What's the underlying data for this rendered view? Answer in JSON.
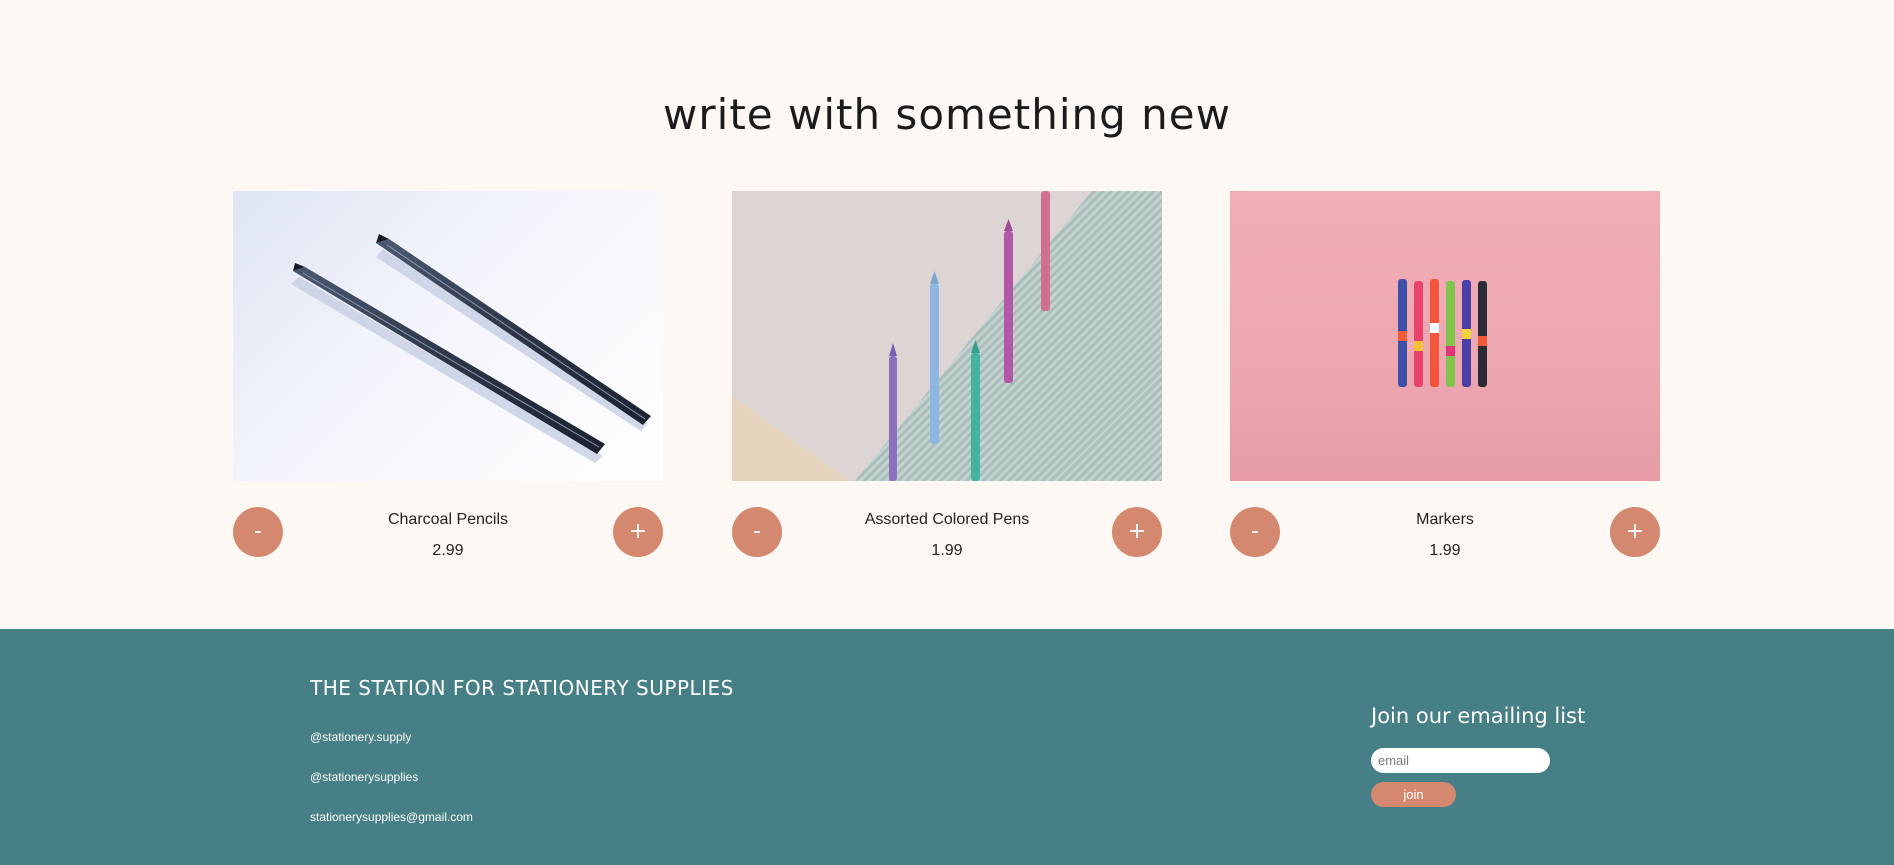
{
  "headline": "write with something new",
  "products": [
    {
      "name": "Charcoal Pencils",
      "price": "2.99",
      "minus_label": "-",
      "plus_label": "+"
    },
    {
      "name": "Assorted Colored Pens",
      "price": "1.99",
      "minus_label": "-",
      "plus_label": "+"
    },
    {
      "name": "Markers",
      "price": "1.99",
      "minus_label": "-",
      "plus_label": "+"
    }
  ],
  "footer": {
    "title": "THE STATION FOR STATIONERY SUPPLIES",
    "links": [
      "@stationery.supply",
      "@stationerysupplies",
      "stationerysupplies@gmail.com"
    ],
    "join_title": "Join our emailing list",
    "email_placeholder": "email",
    "join_label": "join"
  },
  "colors": {
    "page_bg": "#fef8f4",
    "accent": "#d48870",
    "footer_bg": "#477f87"
  }
}
